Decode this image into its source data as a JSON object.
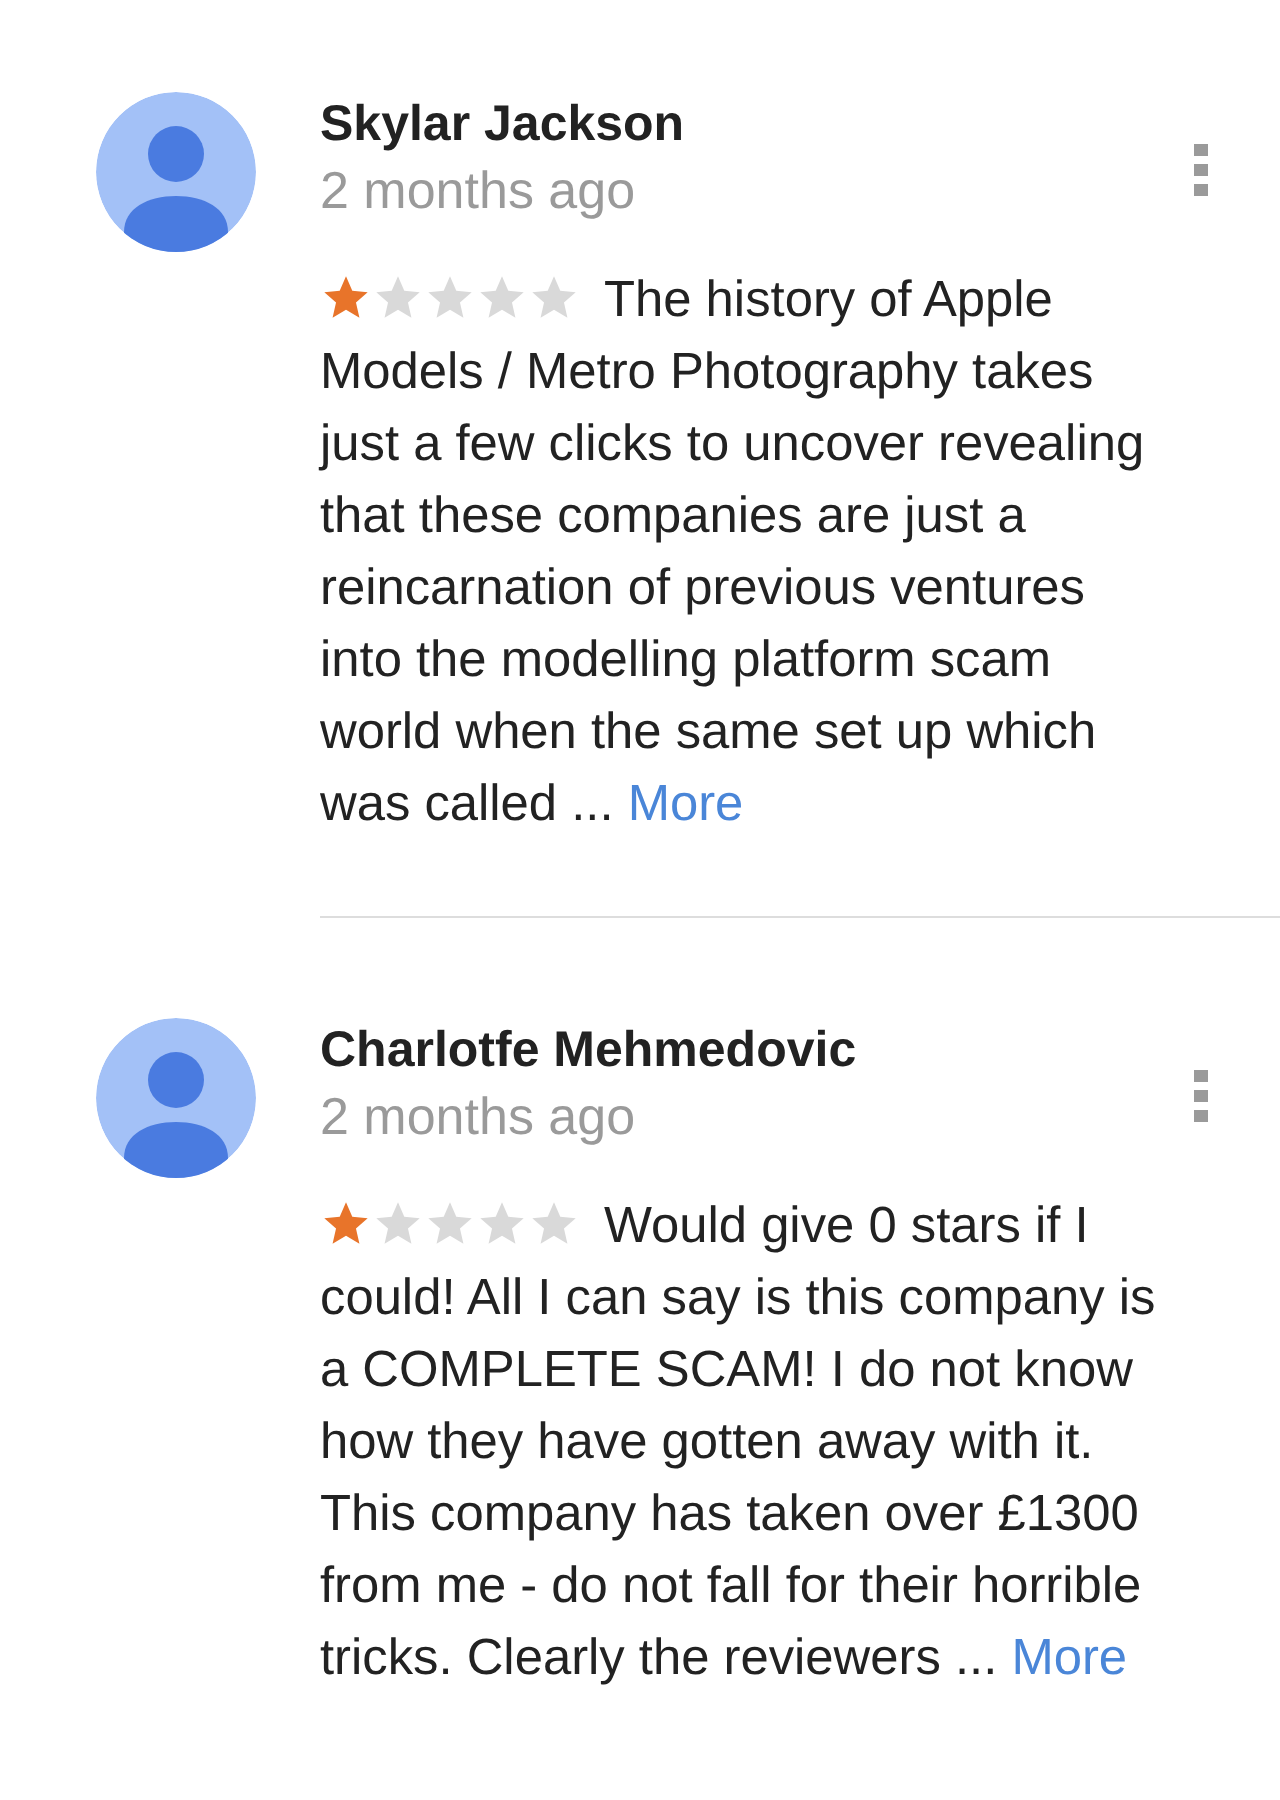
{
  "reviews": [
    {
      "name": "Skylar Jackson",
      "time": "2 months ago",
      "stars": 1,
      "lead": "The history of Apple",
      "text": "Models / Metro Photography takes just a few clicks to uncover revealing that these companies are just a reincarnation of previous ventures into the modelling platform scam world when the same set up which was called ...",
      "more": "More"
    },
    {
      "name": "Charlotfe Mehmedovic",
      "time": "2 months ago",
      "stars": 1,
      "lead": "Would give 0 stars if I",
      "text": "could! All I can say is this company is a COMPLETE SCAM! I do not know how they have gotten away with it. This company has taken over £1300 from me - do not fall for their horrible tricks. Clearly the reviewers ...",
      "more": "More"
    }
  ]
}
